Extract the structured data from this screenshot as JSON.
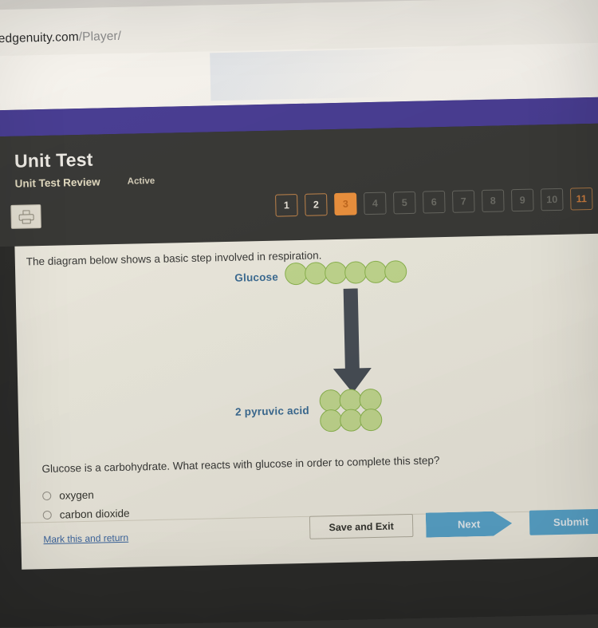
{
  "browser": {
    "url_host": "arn.edgenuity.com",
    "url_path": "/Player/"
  },
  "header": {
    "title": "Unit Test",
    "subtitle": "Unit Test Review",
    "status": "Active",
    "print_icon": "printer-icon",
    "question_nav": [
      {
        "label": "1",
        "state": "done"
      },
      {
        "label": "2",
        "state": "done"
      },
      {
        "label": "3",
        "state": "current"
      },
      {
        "label": "4",
        "state": "pending"
      },
      {
        "label": "5",
        "state": "pending"
      },
      {
        "label": "6",
        "state": "pending"
      },
      {
        "label": "7",
        "state": "pending"
      },
      {
        "label": "8",
        "state": "pending"
      },
      {
        "label": "9",
        "state": "pending"
      },
      {
        "label": "10",
        "state": "pending"
      },
      {
        "label": "11",
        "state": "partial-edge"
      }
    ]
  },
  "content": {
    "prompt": "The diagram below shows a basic step involved in respiration.",
    "diagram": {
      "glucose_label": "Glucose",
      "glucose_molecule_count": 6,
      "arrow_icon": "down-arrow-icon",
      "pyruvic_label": "2 pyruvic acid",
      "pyruvic_molecule_count": 6,
      "molecule_fill_color": "#c7dd92",
      "molecule_border_color": "#8fb950",
      "arrow_color": "#4a5058",
      "label_color": "#3e6f97"
    },
    "question": "Glucose is a carbohydrate. What reacts with glucose in order to complete this step?",
    "options": [
      {
        "label": "oxygen",
        "selected": false
      },
      {
        "label": "carbon dioxide",
        "selected": false
      }
    ]
  },
  "footer": {
    "mark_return_label": "Mark this and return",
    "save_exit_label": "Save and Exit",
    "next_label": "Next",
    "submit_label": "Submit"
  },
  "colors": {
    "brand_purple": "#4b3f96",
    "accent_orange": "#f3953f",
    "button_blue": "#5ba8cf",
    "panel_cream": "#f3f0e4",
    "header_dark": "#3b3b38"
  }
}
